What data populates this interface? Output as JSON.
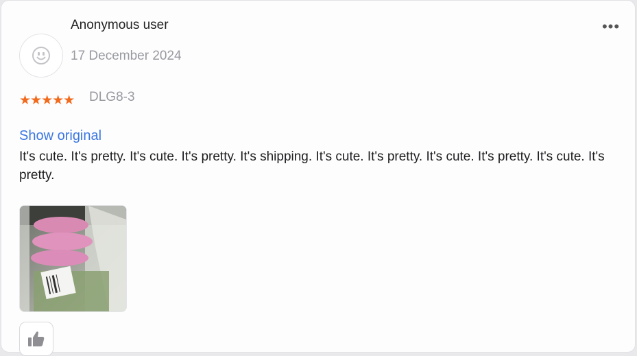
{
  "review": {
    "user_name": "Anonymous user",
    "date": "17 December 2024",
    "stars": "★★★★★",
    "rating": 5,
    "variant": "DLG8-3",
    "show_original": "Show original",
    "text": "It's cute. It's pretty. It's cute. It's pretty. It's shipping. It's cute. It's pretty. It's cute. It's pretty. It's cute. It's pretty.",
    "more_menu": "•••"
  },
  "colors": {
    "star": "#f26b1d",
    "link": "#3b77e0",
    "muted": "#999aa0"
  },
  "icons": {
    "avatar": "smiley-face-icon",
    "like": "thumbs-up-icon",
    "more": "more-horizontal-icon"
  }
}
